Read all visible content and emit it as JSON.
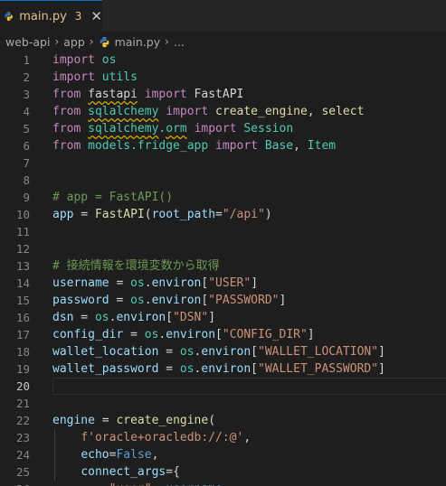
{
  "tab": {
    "filename": "main.py",
    "problem_count": "3",
    "close_glyph": "✕"
  },
  "breadcrumb": {
    "folder1": "web-api",
    "folder2": "app",
    "file": "main.py",
    "more": "...",
    "separator": "›"
  },
  "colors": {
    "keyword": "#c586c0",
    "class": "#4ec9b0",
    "variable": "#9cdcfe",
    "function": "#dcdcaa",
    "string": "#ce9178",
    "comment": "#6a9955",
    "constant": "#569cd6",
    "warning": "#cca700"
  },
  "active_line": 20,
  "lines": [
    [
      [
        "k",
        "import"
      ],
      [
        "p",
        " "
      ],
      [
        "n",
        "os"
      ]
    ],
    [
      [
        "k",
        "import"
      ],
      [
        "p",
        " "
      ],
      [
        "n",
        "utils"
      ]
    ],
    [
      [
        "k",
        "from"
      ],
      [
        "p",
        " "
      ],
      [
        "pw",
        "fastapi"
      ],
      [
        "p",
        " "
      ],
      [
        "k",
        "import"
      ],
      [
        "p",
        " FastAPI"
      ]
    ],
    [
      [
        "k",
        "from"
      ],
      [
        "p",
        " "
      ],
      [
        "nw",
        "sqlalchemy"
      ],
      [
        "p",
        " "
      ],
      [
        "k",
        "import"
      ],
      [
        "p",
        " "
      ],
      [
        "f",
        "create_engine"
      ],
      [
        "p",
        ", "
      ],
      [
        "f",
        "select"
      ]
    ],
    [
      [
        "k",
        "from"
      ],
      [
        "p",
        " "
      ],
      [
        "nw",
        "sqlalchemy"
      ],
      [
        "n",
        "."
      ],
      [
        "nw",
        "orm"
      ],
      [
        "p",
        " "
      ],
      [
        "k",
        "import"
      ],
      [
        "p",
        " "
      ],
      [
        "n",
        "Session"
      ]
    ],
    [
      [
        "k",
        "from"
      ],
      [
        "p",
        " "
      ],
      [
        "n",
        "models.fridge_app"
      ],
      [
        "p",
        " "
      ],
      [
        "k",
        "import"
      ],
      [
        "p",
        " "
      ],
      [
        "n",
        "Base"
      ],
      [
        "p",
        ", "
      ],
      [
        "n",
        "Item"
      ]
    ],
    [],
    [],
    [
      [
        "c",
        "# app = FastAPI()"
      ]
    ],
    [
      [
        "v",
        "app"
      ],
      [
        "p",
        " = "
      ],
      [
        "f",
        "FastAPI"
      ],
      [
        "p",
        "("
      ],
      [
        "v",
        "root_path"
      ],
      [
        "p",
        "="
      ],
      [
        "s",
        "\"/api\""
      ],
      [
        "p",
        ")"
      ]
    ],
    [],
    [],
    [
      [
        "c",
        "# 接続情報を環境変数から取得"
      ]
    ],
    [
      [
        "v",
        "username"
      ],
      [
        "p",
        " = "
      ],
      [
        "n",
        "os"
      ],
      [
        "p",
        "."
      ],
      [
        "v",
        "environ"
      ],
      [
        "p",
        "["
      ],
      [
        "s",
        "\"USER\""
      ],
      [
        "p",
        "]"
      ]
    ],
    [
      [
        "v",
        "password"
      ],
      [
        "p",
        " = "
      ],
      [
        "n",
        "os"
      ],
      [
        "p",
        "."
      ],
      [
        "v",
        "environ"
      ],
      [
        "p",
        "["
      ],
      [
        "s",
        "\"PASSWORD\""
      ],
      [
        "p",
        "]"
      ]
    ],
    [
      [
        "v",
        "dsn"
      ],
      [
        "p",
        " = "
      ],
      [
        "n",
        "os"
      ],
      [
        "p",
        "."
      ],
      [
        "v",
        "environ"
      ],
      [
        "p",
        "["
      ],
      [
        "s",
        "\"DSN\""
      ],
      [
        "p",
        "]"
      ]
    ],
    [
      [
        "v",
        "config_dir"
      ],
      [
        "p",
        " = "
      ],
      [
        "n",
        "os"
      ],
      [
        "p",
        "."
      ],
      [
        "v",
        "environ"
      ],
      [
        "p",
        "["
      ],
      [
        "s",
        "\"CONFIG_DIR\""
      ],
      [
        "p",
        "]"
      ]
    ],
    [
      [
        "v",
        "wallet_location"
      ],
      [
        "p",
        " = "
      ],
      [
        "n",
        "os"
      ],
      [
        "p",
        "."
      ],
      [
        "v",
        "environ"
      ],
      [
        "p",
        "["
      ],
      [
        "s",
        "\"WALLET_LOCATION\""
      ],
      [
        "p",
        "]"
      ]
    ],
    [
      [
        "v",
        "wallet_password"
      ],
      [
        "p",
        " = "
      ],
      [
        "n",
        "os"
      ],
      [
        "p",
        "."
      ],
      [
        "v",
        "environ"
      ],
      [
        "p",
        "["
      ],
      [
        "s",
        "\"WALLET_PASSWORD\""
      ],
      [
        "p",
        "]"
      ]
    ],
    [],
    [],
    [
      [
        "v",
        "engine"
      ],
      [
        "p",
        " = "
      ],
      [
        "f",
        "create_engine"
      ],
      [
        "p",
        "("
      ]
    ],
    [
      [
        "p",
        "    "
      ],
      [
        "s",
        "f'oracle+oracledb://:@'"
      ],
      [
        "p",
        ","
      ]
    ],
    [
      [
        "p",
        "    "
      ],
      [
        "v",
        "echo"
      ],
      [
        "p",
        "="
      ],
      [
        "b",
        "False"
      ],
      [
        "p",
        ","
      ]
    ],
    [
      [
        "p",
        "    "
      ],
      [
        "v",
        "connect_args"
      ],
      [
        "p",
        "="
      ],
      [
        "p",
        "{"
      ]
    ],
    [
      [
        "p",
        "        "
      ],
      [
        "s",
        "\"user\""
      ],
      [
        "p",
        ": "
      ],
      [
        "v",
        "username"
      ],
      [
        "p",
        ","
      ]
    ]
  ]
}
